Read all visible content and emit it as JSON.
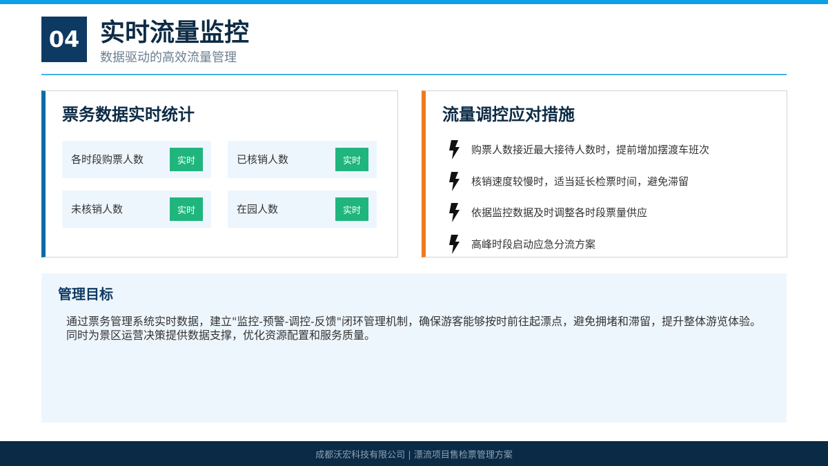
{
  "header": {
    "number": "04",
    "title": "实时流量监控",
    "subtitle": "数据驱动的高效流量管理"
  },
  "stats_card": {
    "title": "票务数据实时统计",
    "items": [
      {
        "label": "各时段购票人数",
        "badge": "实时"
      },
      {
        "label": "已核销人数",
        "badge": "实时"
      },
      {
        "label": "未核销人数",
        "badge": "实时"
      },
      {
        "label": "在园人数",
        "badge": "实时"
      }
    ]
  },
  "measures_card": {
    "title": "流量调控应对措施",
    "items": [
      {
        "icon": "lightning-bolt-icon",
        "text": "购票人数接近最大接待人数时，提前增加摆渡车班次"
      },
      {
        "icon": "lightning-bolt-icon",
        "text": "核销速度较慢时，适当延长检票时间，避免滞留"
      },
      {
        "icon": "lightning-bolt-icon",
        "text": "依据监控数据及时调整各时段票量供应"
      },
      {
        "icon": "lightning-bolt-icon",
        "text": "高峰时段启动应急分流方案"
      }
    ]
  },
  "goal": {
    "title": "管理目标",
    "text": "通过票务管理系统实时数据，建立\"监控-预警-调控-反馈\"闭环管理机制，确保游客能够按时前往起漂点，避免拥堵和滞留，提升整体游览体验。同时为景区运营决策提供数据支撑，优化资源配置和服务质量。"
  },
  "footer": {
    "text": "成都沃宏科技有限公司 | 漂流项目售检票管理方案"
  },
  "colors": {
    "accent_blue": "#0ea0e6",
    "navy": "#0d3a63",
    "orange": "#ef7a22",
    "green": "#1fb57d"
  }
}
